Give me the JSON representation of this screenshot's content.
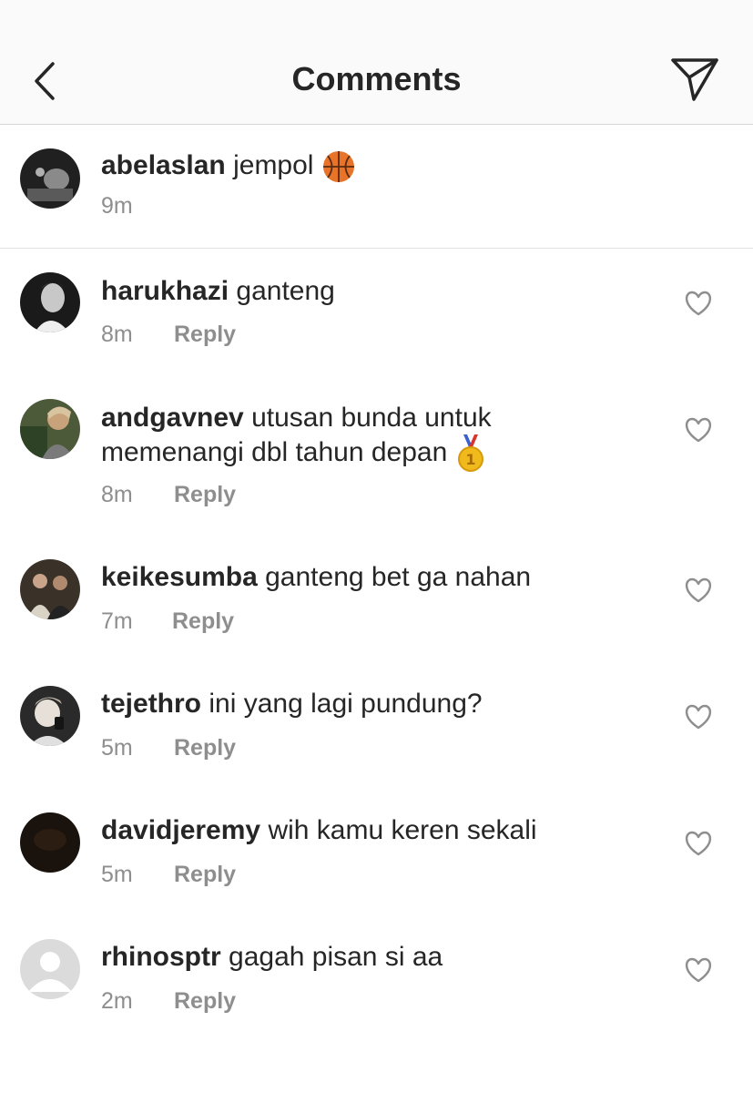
{
  "header": {
    "title": "Comments"
  },
  "caption": {
    "username": "abelaslan",
    "text": "jempol",
    "emoji": "basketball-icon",
    "time": "9m"
  },
  "reply_label": "Reply",
  "comments": [
    {
      "username": "harukhazi",
      "text": "ganteng",
      "time": "8m"
    },
    {
      "username": "andgavnev",
      "text": "utusan bunda untuk",
      "text2": "memenangi dbl tahun depan",
      "emoji": "gold-medal-icon",
      "time": "8m"
    },
    {
      "username": "keikesumba",
      "text": "ganteng bet ga nahan",
      "time": "7m"
    },
    {
      "username": "tejethro",
      "text": "ini yang lagi pundung?",
      "time": "5m"
    },
    {
      "username": "davidjeremy",
      "text": "wih kamu keren sekali",
      "time": "5m"
    },
    {
      "username": "rhinosptr",
      "text": "gagah pisan si aa",
      "time": "2m"
    }
  ],
  "colors": {
    "text": "#262626",
    "muted": "#8e8e8e",
    "header_bg": "#fafafa",
    "divider": "#d6d6d6"
  }
}
